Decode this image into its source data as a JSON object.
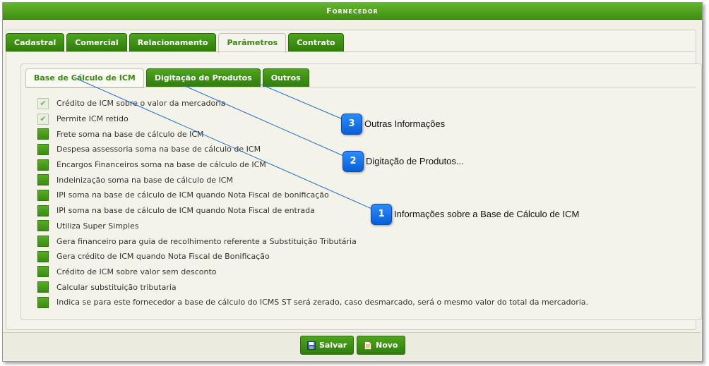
{
  "window": {
    "title": "Fornecedor"
  },
  "tabs": [
    {
      "label": "Cadastral",
      "active": false
    },
    {
      "label": "Comercial",
      "active": false
    },
    {
      "label": "Relacionamento",
      "active": false
    },
    {
      "label": "Parâmetros",
      "active": true
    },
    {
      "label": "Contrato",
      "active": false
    }
  ],
  "subtabs": [
    {
      "label": "Base de Cálculo de ICM",
      "active": true
    },
    {
      "label": "Digitação de Produtos",
      "active": false
    },
    {
      "label": "Outros",
      "active": false
    }
  ],
  "options": [
    {
      "label": "Crédito de ICM sobre o valor da mercadoria",
      "checked": true
    },
    {
      "label": "Permite ICM retido",
      "checked": true
    },
    {
      "label": "Frete soma na base de cálculo de ICM",
      "checked": false
    },
    {
      "label": "Despesa assessoria soma na base de cálculo de ICM",
      "checked": false
    },
    {
      "label": "Encargos Financeiros soma na base de cálculo de ICM",
      "checked": false
    },
    {
      "label": "Indeinização soma na base de cálculo de ICM",
      "checked": false
    },
    {
      "label": "IPI soma na base de cálculo de ICM quando Nota Fiscal de bonificação",
      "checked": false
    },
    {
      "label": "IPI soma na base de cálculo de ICM quando Nota Fiscal de entrada",
      "checked": false
    },
    {
      "label": "Utiliza Super Simples",
      "checked": false
    },
    {
      "label": "Gera financeiro para guia de recolhimento referente a Substituição Tributária",
      "checked": false
    },
    {
      "label": "Gera crédito de ICM quando Nota Fiscal de Bonificação",
      "checked": false
    },
    {
      "label": "Crédito de ICM sobre valor sem desconto",
      "checked": false
    },
    {
      "label": "Calcular substituição tributaria",
      "checked": false
    },
    {
      "label": "Indica se para este fornecedor a base de cálculo do ICMS ST será zerado, caso desmarcado, será o mesmo valor do total da mercadoria.",
      "checked": false
    }
  ],
  "buttons": {
    "save_label": "Salvar",
    "new_label": "Novo"
  },
  "callouts": [
    {
      "number": "1",
      "text": "Informações sobre a Base de Cálculo de ICM"
    },
    {
      "number": "2",
      "text": "Digitação de Produtos..."
    },
    {
      "number": "3",
      "text": "Outras Informações"
    }
  ],
  "colors": {
    "accent": "#3a8a12",
    "callout": "#1a73e8"
  }
}
